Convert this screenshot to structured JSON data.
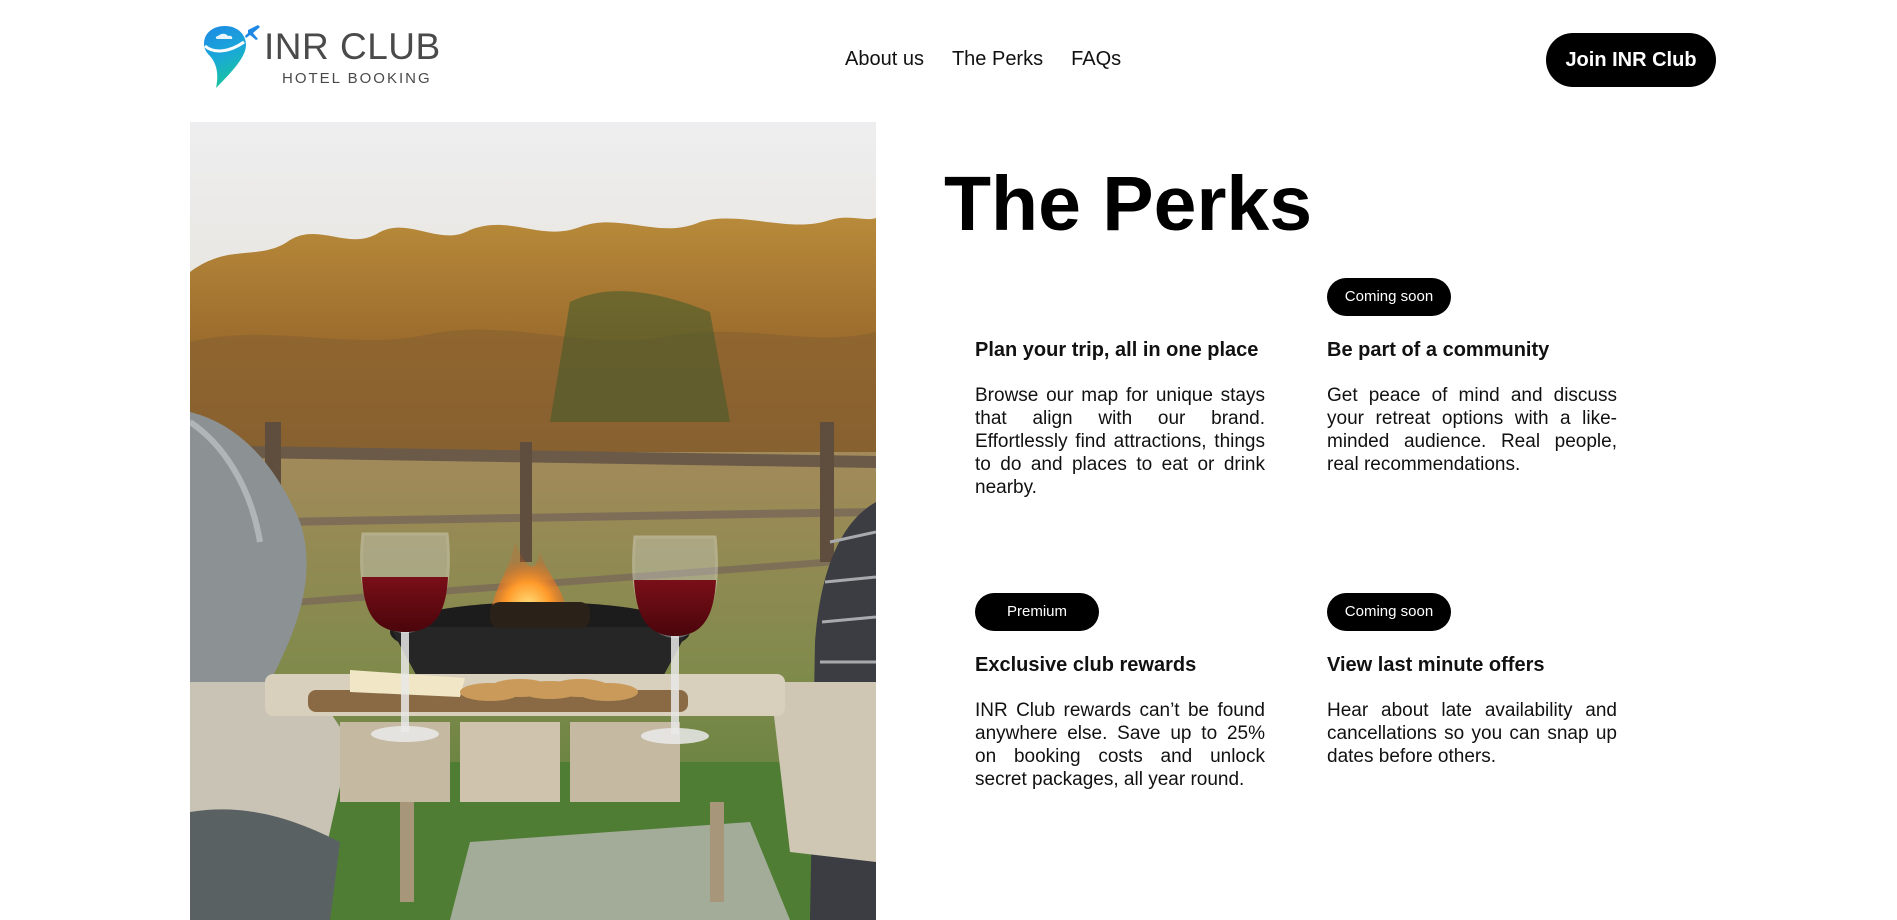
{
  "brand": {
    "name": "INR CLUB",
    "tagline": "HOTEL BOOKING"
  },
  "nav": {
    "items": [
      {
        "label": "About us"
      },
      {
        "label": "The Perks"
      },
      {
        "label": "FAQs"
      }
    ],
    "cta_label": "Join INR Club"
  },
  "hero_image": {
    "description": "Two glasses of red wine on a wooden table with cheese and crackers beside a fire pit in an autumn field"
  },
  "perks": {
    "title": "The Perks",
    "items": [
      {
        "badge": "",
        "title": "Plan your trip, all in one place",
        "description": "Browse our map for unique stays that align with our brand. Effortlessly find attractions, things to do and places to eat or drink nearby."
      },
      {
        "badge": "Coming soon",
        "title": "Be part of a community",
        "description": "Get peace of mind and discuss your retreat options with a like-minded audience. Real people, real recommendations."
      },
      {
        "badge": "Premium",
        "title": "Exclusive club rewards",
        "description": "INR Club rewards can’t be found anywhere else. Save up to 25% on booking costs and unlock secret packages, all year round."
      },
      {
        "badge": "Coming soon",
        "title": "View last minute offers",
        "description": "Hear about late availability and cancellations so you can snap up dates before others."
      }
    ]
  },
  "colors": {
    "accent": "#000000",
    "logo_blue": "#1e88e5",
    "logo_teal": "#19c2a0"
  }
}
